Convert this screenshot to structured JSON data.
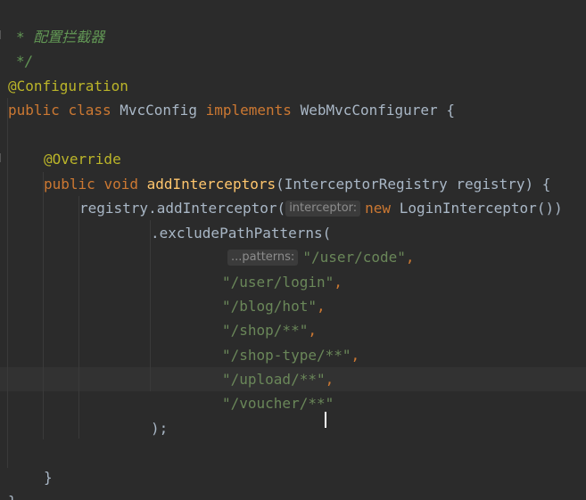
{
  "editor": {
    "lines": {
      "l1_comment": "* 配置拦截器",
      "l2_comment": "*/",
      "l3_annotation": "@Configuration",
      "l4_public": "public",
      "l4_class": "class",
      "l4_name": "MvcConfig",
      "l4_implements": "implements",
      "l4_interface": "WebMvcConfigurer {",
      "l6_override": "@Override",
      "l7_public": "public",
      "l7_void": "void",
      "l7_method": "addInterceptors",
      "l7_params": "(InterceptorRegistry registry) {",
      "l8_call": "registry.addInterceptor(",
      "l8_hint": "interceptor:",
      "l8_new": "new",
      "l8_rest": "LoginInterceptor())",
      "l9_call": ".excludePathPatterns(",
      "l10_hint": "...patterns:",
      "l10_str": "\"/user/code\"",
      "l11_str": "\"/user/login\"",
      "l12_str": "\"/blog/hot\"",
      "l13_str": "\"/shop/**\"",
      "l14_str": "\"/shop-type/**\"",
      "l15_str": "\"/upload/**\"",
      "l16_str_a": "\"/voucher/**",
      "l16_str_b": "\"",
      "l17_close": ");",
      "l19_brace": "}",
      "l20_brace": "}",
      "comma": ","
    }
  }
}
